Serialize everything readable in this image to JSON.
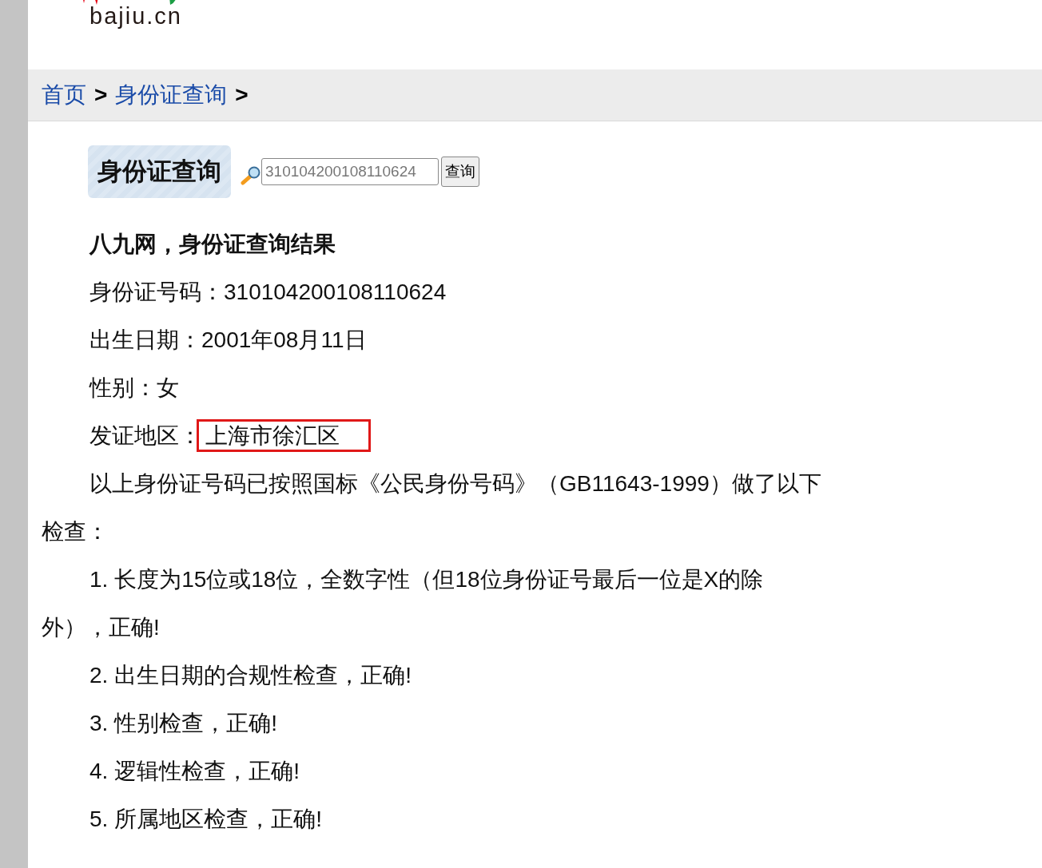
{
  "logo": {
    "text": "bajiu.cn"
  },
  "breadcrumb": [
    {
      "label": "首页",
      "kind": "link"
    },
    {
      "label": ">",
      "kind": "sep"
    },
    {
      "label": "身份证查询",
      "kind": "link"
    },
    {
      "label": ">",
      "kind": "sep"
    }
  ],
  "search": {
    "title": "身份证查询",
    "placeholder": "310104200108110624",
    "button": "查询"
  },
  "result": {
    "heading": "八九网，身份证查询结果",
    "fields": [
      {
        "label": "身份证号码：",
        "value": "310104200108110624",
        "highlighted": false
      },
      {
        "label": "出生日期：",
        "value": "2001年08月11日",
        "highlighted": false
      },
      {
        "label": "性别：",
        "value": "女",
        "highlighted": false
      },
      {
        "label": "发证地区：",
        "value": "上海市徐汇区",
        "highlighted": true
      }
    ],
    "intro": "以上身份证号码已按照国标《公民身份号码》（GB11643-1999）做了以下检查：",
    "checks": [
      "1. 长度为15位或18位，全数字性（但18位身份证号最后一位是X的除外），正确!",
      "2. 出生日期的合规性检查，正确!",
      "3. 性别检查，正确!",
      "4. 逻辑性检查，正确!",
      "5. 所属地区检查，正确!"
    ]
  }
}
